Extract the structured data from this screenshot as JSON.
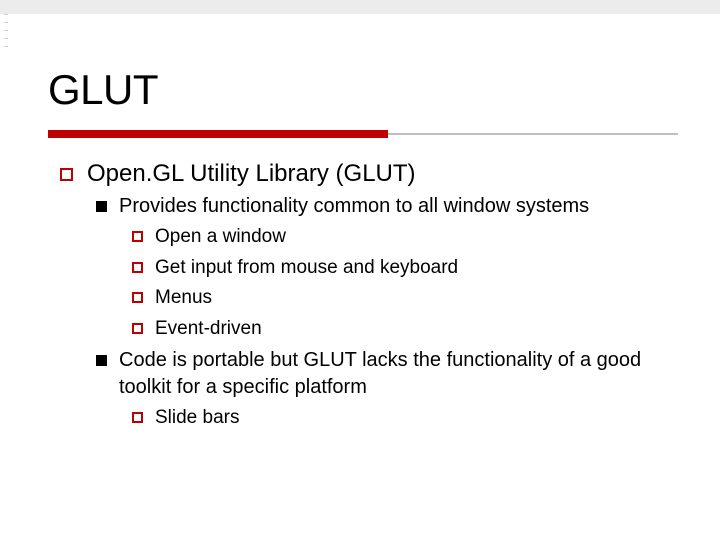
{
  "title": "GLUT",
  "outline": {
    "l1": "Open.GL Utility Library (GLUT)",
    "l2a": "Provides functionality common to all window systems",
    "l3a": "Open a window",
    "l3b": "Get input from mouse and keyboard",
    "l3c": "Menus",
    "l3d": "Event-driven",
    "l2b": "Code is portable but GLUT lacks the functionality of a good toolkit for a specific platform",
    "l3e": "Slide bars"
  }
}
